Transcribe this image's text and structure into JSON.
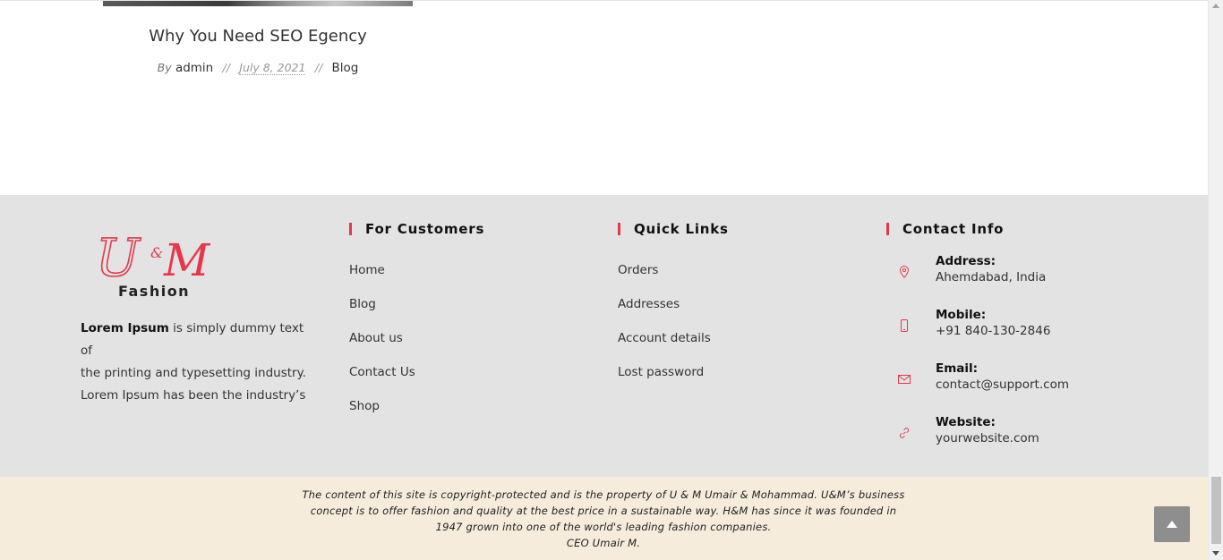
{
  "post": {
    "title": "Why You Need SEO Egency",
    "by_label": "By",
    "author": "admin",
    "separator": "//",
    "date": "July 8, 2021",
    "category": "Blog"
  },
  "footer": {
    "logo": {
      "mark": "U&M",
      "mark_main": "U",
      "mark_amp": "&",
      "mark_end": "M",
      "subtitle": "Fashion"
    },
    "about": {
      "bold": "Lorem Ipsum",
      "line1_rest": " is simply dummy text of",
      "line2": "the printing and typesetting industry.",
      "line3": "Lorem Ipsum has been the industry’s"
    },
    "customers": {
      "title": "For Customers",
      "links": [
        "Home",
        "Blog",
        "About us",
        "Contact Us",
        "Shop"
      ]
    },
    "quick_links": {
      "title": "Quick Links",
      "links": [
        "Orders",
        "Addresses",
        "Account details",
        "Lost password"
      ]
    },
    "contact": {
      "title": "Contact Info",
      "items": [
        {
          "label": "Address:",
          "value": "Ahemdabad, India",
          "icon": "map-pin-icon"
        },
        {
          "label": "Mobile:",
          "value": "+91 840-130-2846",
          "icon": "mobile-phone-icon"
        },
        {
          "label": "Email:",
          "value": "contact@support.com",
          "icon": "envelope-icon"
        },
        {
          "label": "Website:",
          "value": "yourwebsite.com",
          "icon": "link-icon"
        }
      ]
    }
  },
  "copyright": {
    "line1": "The content of this site is copyright-protected and is the property of U & M Umair & Mohammad. U&M’s business",
    "line2": "concept is to offer fashion and quality at the best price in a sustainable way. H&M has since it was founded in",
    "line3": "1947 grown into one of the world's leading fashion companies.",
    "line4": "CEO Umair M."
  },
  "colors": {
    "accent": "#e5384b",
    "footer_bg": "#e3e3e3",
    "copyright_bg": "#f5ecdc",
    "scroll_top_bg": "#8e8e8e"
  }
}
